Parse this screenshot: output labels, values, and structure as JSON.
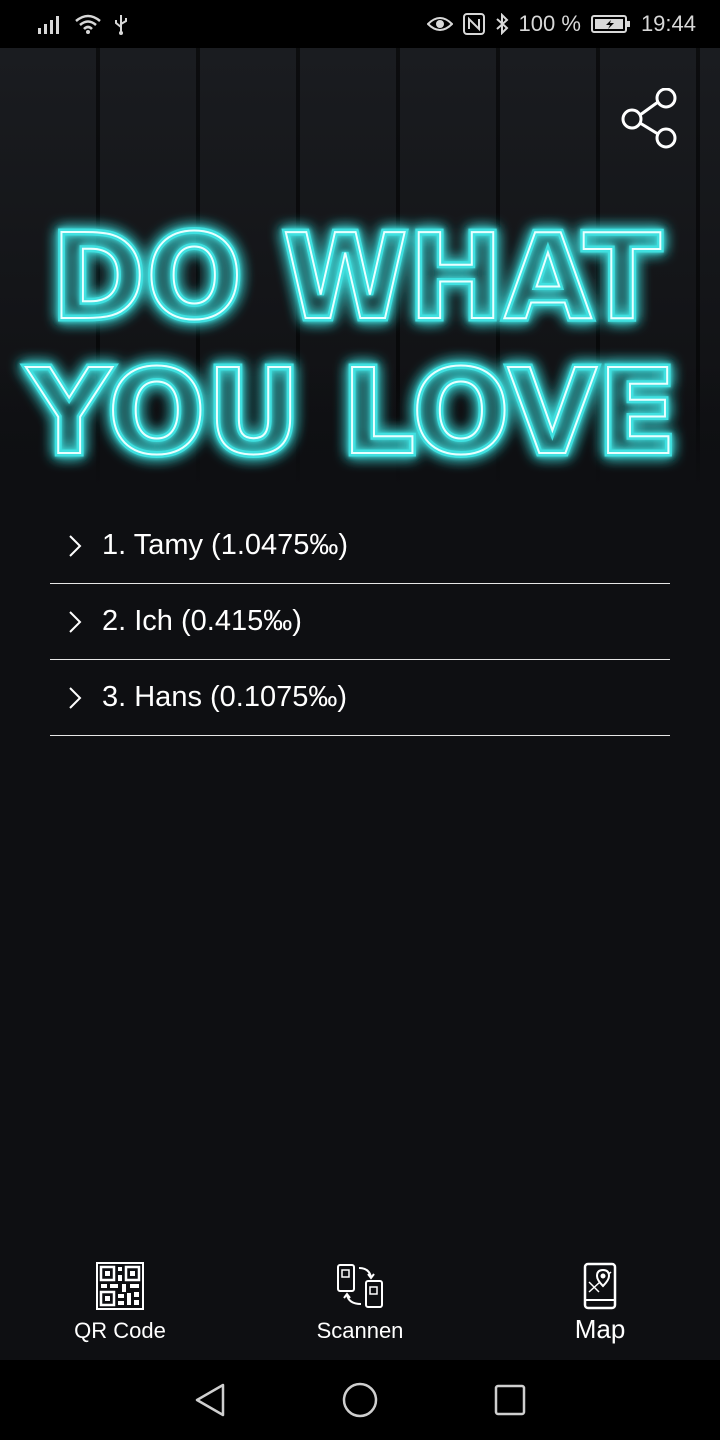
{
  "statusbar": {
    "battery": "100 %",
    "time": "19:44"
  },
  "hero": {
    "line1": "DO WHAT",
    "line2": "YOU LOVE",
    "neon_color": "#3fe0e0"
  },
  "ranking": [
    {
      "label": "1. Tamy (1.0475‰)"
    },
    {
      "label": "2. Ich (0.415‰)"
    },
    {
      "label": "3. Hans (0.1075‰)"
    }
  ],
  "bottom_nav": {
    "qr_label": "QR Code",
    "scan_label": "Scannen",
    "map_label": "Map"
  }
}
